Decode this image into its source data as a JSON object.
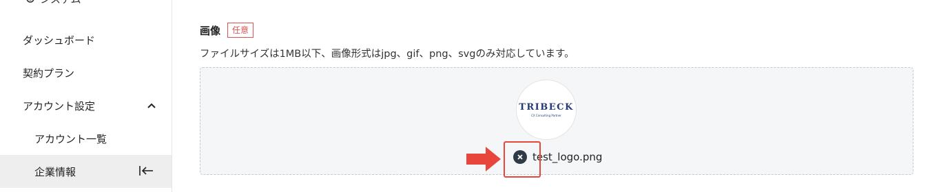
{
  "sidebar": {
    "top_label": "システム",
    "items": [
      {
        "label": "ダッシュボード"
      },
      {
        "label": "契約プラン"
      },
      {
        "label": "アカウント設定"
      },
      {
        "label": "アカウント一覧"
      },
      {
        "label": "企業情報"
      }
    ]
  },
  "main": {
    "field_title": "画像",
    "badge": "任意",
    "description": "ファイルサイズは1MB以下、画像形式はjpg、gif、png、svgのみ対応しています。",
    "logo": {
      "text": "TRIBECK",
      "tagline": "CX Consulting Partner"
    },
    "file_name": "test_logo.png"
  },
  "colors": {
    "accent": "#e8453c",
    "logo_navy": "#253a73",
    "active_bg": "#eeeeee"
  }
}
